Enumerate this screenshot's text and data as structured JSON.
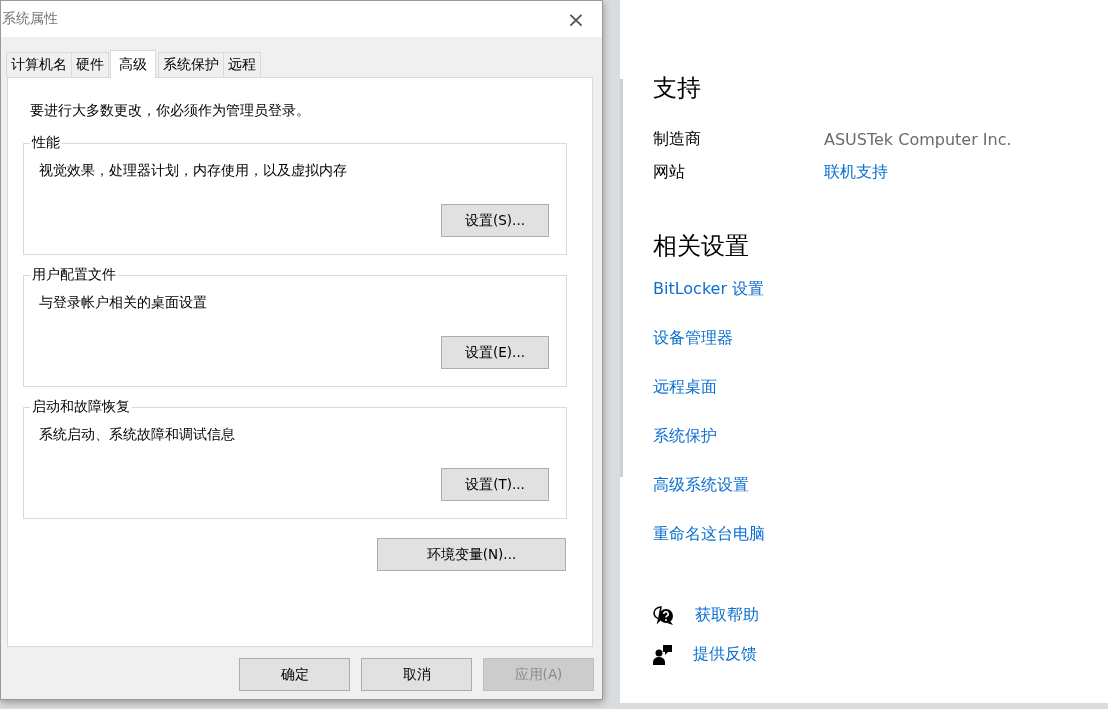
{
  "window": {
    "title": "系统属性",
    "close": "×"
  },
  "tabs": [
    {
      "label": "计算机名",
      "selected": false
    },
    {
      "label": "硬件",
      "selected": false
    },
    {
      "label": "高级",
      "selected": true
    },
    {
      "label": "系统保护",
      "selected": false
    },
    {
      "label": "远程",
      "selected": false
    }
  ],
  "notice": "要进行大多数更改，你必须作为管理员登录。",
  "groups": [
    {
      "title": "性能",
      "description": "视觉效果，处理器计划，内存使用，以及虚拟内存",
      "button": "设置(S)..."
    },
    {
      "title": "用户配置文件",
      "description": "与登录帐户相关的桌面设置",
      "button": "设置(E)..."
    },
    {
      "title": "启动和故障恢复",
      "description": "系统启动、系统故障和调试信息",
      "button": "设置(T)..."
    }
  ],
  "env_button": "环境变量(N)...",
  "footer_buttons": [
    {
      "label": "确定",
      "disabled": false
    },
    {
      "label": "取消",
      "disabled": false
    },
    {
      "label": "应用(A)",
      "disabled": true
    }
  ],
  "support": {
    "heading": "支持",
    "rows": [
      {
        "label": "制造商",
        "value": "ASUSTek Computer Inc.",
        "kind": "text"
      },
      {
        "label": "网站",
        "value": "联机支持",
        "kind": "link"
      }
    ]
  },
  "related": {
    "heading": "相关设置",
    "links": [
      "BitLocker 设置",
      "设备管理器",
      "远程桌面",
      "系统保护",
      "高级系统设置",
      "重命名这台电脑"
    ]
  },
  "help_links": [
    {
      "label": "获取帮助",
      "kind": "help"
    },
    {
      "label": "提供反馈",
      "kind": "feedback"
    }
  ]
}
